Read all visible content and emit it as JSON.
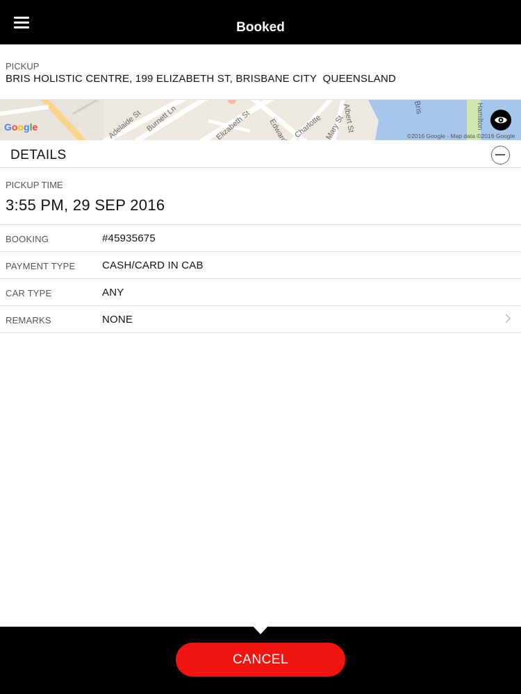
{
  "header": {
    "title": "Booked",
    "menu_icon": "hamburger-menu-icon"
  },
  "pickup": {
    "label": "PICKUP",
    "address": "BRIS HOLISTIC CENTRE, 199 ELIZABETH ST, BRISBANE CITY  QUEENSLAND"
  },
  "map": {
    "logo": "Google",
    "attribution": "©2016 Google - Map data ©2016 Google",
    "streets": [
      "Adelaide St",
      "Burnett Ln",
      "Elizabeth St",
      "Edward St",
      "Charlotte",
      "Albert St",
      "Mary St",
      "Bris",
      "Hamilton"
    ],
    "eye_icon": "eye-icon"
  },
  "details": {
    "title": "DETAILS",
    "collapse_icon": "minus-circle-icon"
  },
  "pickup_time": {
    "label": "PICKUP TIME",
    "value": "3:55 PM, 29 SEP 2016"
  },
  "rows": [
    {
      "label": "BOOKING",
      "value": "#45935675"
    },
    {
      "label": "PAYMENT TYPE",
      "value": "CASH/CARD IN CAB"
    },
    {
      "label": "CAR TYPE",
      "value": "ANY"
    },
    {
      "label": "REMARKS",
      "value": "NONE"
    }
  ],
  "footer": {
    "cancel_label": "CANCEL"
  },
  "colors": {
    "header_bg": "#000000",
    "accent_red": "#f21410",
    "water": "#a6c6ec"
  }
}
